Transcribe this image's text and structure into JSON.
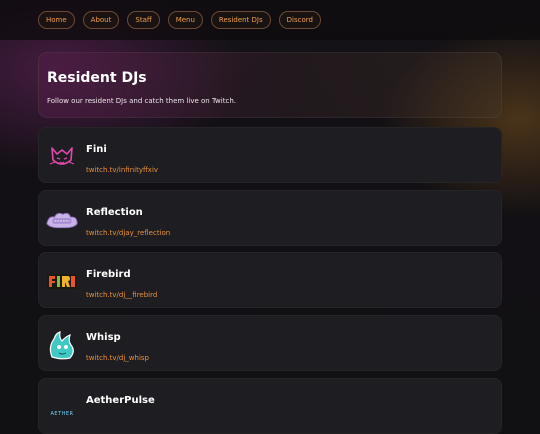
{
  "nav": {
    "items": [
      {
        "label": "Home"
      },
      {
        "label": "About"
      },
      {
        "label": "Staff"
      },
      {
        "label": "Menu"
      },
      {
        "label": "Resident DJs"
      },
      {
        "label": "Discord"
      }
    ]
  },
  "hero": {
    "title": "Resident DJs",
    "subtitle": "Follow our resident DJs and catch them live on Twitch."
  },
  "djs": [
    {
      "name": "Fini",
      "link": "twitch.tv/infinityffxiv",
      "icon": "cat-logo-icon"
    },
    {
      "name": "Reflection",
      "link": "twitch.tv/djay_reflection",
      "icon": "reflection-logo-icon"
    },
    {
      "name": "Firebird",
      "link": "twitch.tv/dj__firebird",
      "icon": "firebird-logo-icon"
    },
    {
      "name": "Whisp",
      "link": "twitch.tv/dj_whisp",
      "icon": "whisp-logo-icon"
    },
    {
      "name": "AetherPulse",
      "link": "",
      "icon": "aetherpulse-logo-icon",
      "logo_text": "AETHER"
    }
  ],
  "colors": {
    "accent": "#e8923c",
    "card": "#1e1d21",
    "background": "#111013"
  }
}
